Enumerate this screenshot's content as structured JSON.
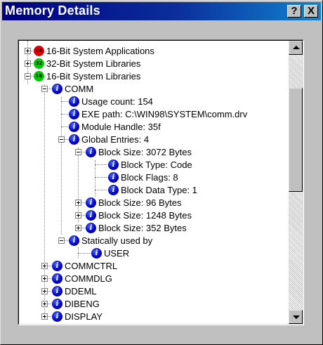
{
  "window": {
    "title": "Memory Details",
    "help_button": "?",
    "close_button": "X"
  },
  "tree": {
    "items": [
      {
        "label": "16-Bit System Applications",
        "icon": "red-icon",
        "icon_text": "16",
        "expander": "plus"
      },
      {
        "label": "32-Bit System Libraries",
        "icon": "green-icon",
        "icon_text": "32",
        "expander": "plus"
      },
      {
        "label": "16-Bit System Libraries",
        "icon": "green-icon",
        "icon_text": "16",
        "expander": "minus"
      },
      {
        "label": "COMM",
        "icon": "info-icon",
        "expander": "minus"
      },
      {
        "label": "Usage count: 154",
        "icon": "info-icon"
      },
      {
        "label": "EXE path: C:\\WIN98\\SYSTEM\\comm.drv",
        "icon": "info-icon"
      },
      {
        "label": "Module Handle: 35f",
        "icon": "info-icon"
      },
      {
        "label": "Global Entries: 4",
        "icon": "info-icon",
        "expander": "minus"
      },
      {
        "label": "Block Size: 3072 Bytes",
        "icon": "info-icon",
        "expander": "minus"
      },
      {
        "label": "Block Type: Code",
        "icon": "info-icon"
      },
      {
        "label": "Block Flags: 8",
        "icon": "info-icon"
      },
      {
        "label": "Block Data Type: 1",
        "icon": "info-icon"
      },
      {
        "label": "Block Size: 96 Bytes",
        "icon": "info-icon",
        "expander": "plus"
      },
      {
        "label": "Block Size: 1248 Bytes",
        "icon": "info-icon",
        "expander": "plus"
      },
      {
        "label": "Block Size: 352 Bytes",
        "icon": "info-icon",
        "expander": "plus"
      },
      {
        "label": "Statically used by",
        "icon": "info-icon",
        "expander": "minus"
      },
      {
        "label": "USER",
        "icon": "info-icon"
      },
      {
        "label": "COMMCTRL",
        "icon": "info-icon",
        "expander": "plus"
      },
      {
        "label": "COMMDLG",
        "icon": "info-icon",
        "expander": "plus"
      },
      {
        "label": "DDEML",
        "icon": "info-icon",
        "expander": "plus"
      },
      {
        "label": "DIBENG",
        "icon": "info-icon",
        "expander": "plus"
      },
      {
        "label": "DISPLAY",
        "icon": "info-icon",
        "expander": "plus"
      }
    ]
  },
  "colors": {
    "title_gradient_start": "#000080",
    "title_gradient_end": "#1084d0",
    "info_icon": "#0000cc",
    "red_icon": "#e00000",
    "green_icon": "#00c800"
  }
}
